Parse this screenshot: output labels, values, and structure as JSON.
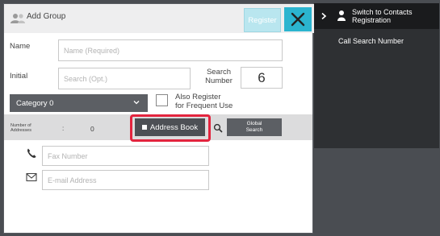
{
  "dialog": {
    "title": "Add Group",
    "register_label": "Register",
    "name_label": "Name",
    "name_placeholder": "Name (Required)",
    "initial_label": "Initial",
    "initial_placeholder": "Search (Opt.)",
    "search_number_label": "Search\nNumber",
    "search_number_value": "6",
    "category_value": "Category 0",
    "also_register_label": "Also Register\nfor Frequent Use",
    "number_of_addresses_label": "Number of\nAddresses",
    "colon": ":",
    "number_of_addresses_value": "0",
    "address_book_label": "Address Book",
    "global_search_label": "Global\nSearch",
    "fax_placeholder": "Fax Number",
    "email_placeholder": "E-mail Address"
  },
  "side_panel": {
    "switch_contacts_label": "Switch to Contacts\nRegistration",
    "call_search_number_label": "Call Search Number"
  },
  "icons": {
    "group": "group-icon",
    "close": "close-icon",
    "chevron": "chevron-down-icon",
    "book": "book-icon",
    "search": "search-icon",
    "fax": "fax-icon",
    "email": "email-icon",
    "side_chevron": "chevron-right-icon",
    "contact": "contact-icon"
  },
  "colors": {
    "accent": "#2bb4cf",
    "highlight": "#e3243e",
    "dark_button": "#4d5055",
    "side_panel": "#2e3033"
  }
}
